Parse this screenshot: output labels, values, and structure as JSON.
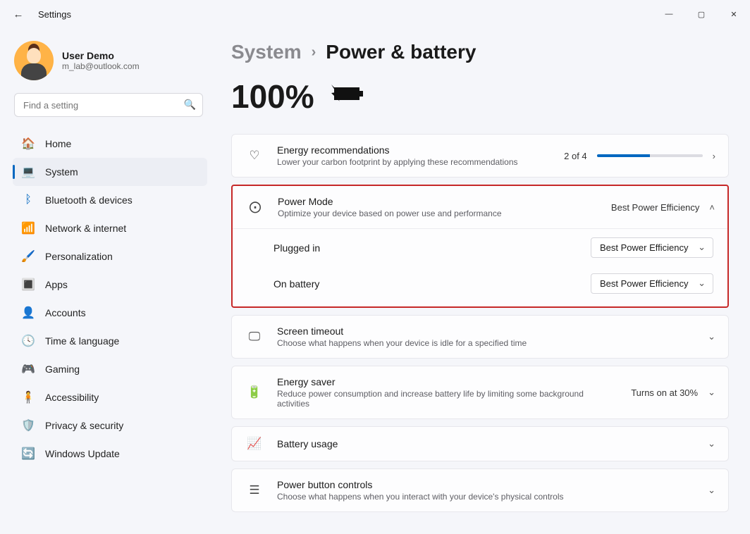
{
  "window": {
    "title": "Settings"
  },
  "user": {
    "name": "User Demo",
    "email": "m_lab@outlook.com"
  },
  "search": {
    "placeholder": "Find a setting"
  },
  "nav": {
    "items": [
      {
        "label": "Home"
      },
      {
        "label": "System"
      },
      {
        "label": "Bluetooth & devices"
      },
      {
        "label": "Network & internet"
      },
      {
        "label": "Personalization"
      },
      {
        "label": "Apps"
      },
      {
        "label": "Accounts"
      },
      {
        "label": "Time & language"
      },
      {
        "label": "Gaming"
      },
      {
        "label": "Accessibility"
      },
      {
        "label": "Privacy & security"
      },
      {
        "label": "Windows Update"
      }
    ]
  },
  "breadcrumb": {
    "parent": "System",
    "current": "Power & battery"
  },
  "battery": {
    "percent": "100%"
  },
  "energy_rec": {
    "title": "Energy recommendations",
    "sub": "Lower your carbon footprint by applying these recommendations",
    "count_text": "2 of 4",
    "progress_pct": 50
  },
  "power_mode": {
    "title": "Power Mode",
    "sub": "Optimize your device based on power use and performance",
    "summary": "Best Power Efficiency",
    "plugged_label": "Plugged in",
    "plugged_value": "Best Power Efficiency",
    "battery_label": "On battery",
    "battery_value": "Best Power Efficiency"
  },
  "screen_timeout": {
    "title": "Screen timeout",
    "sub": "Choose what happens when your device is idle for a specified time"
  },
  "energy_saver": {
    "title": "Energy saver",
    "sub": "Reduce power consumption and increase battery life by limiting some background activities",
    "value": "Turns on at 30%"
  },
  "battery_usage": {
    "title": "Battery usage"
  },
  "power_button": {
    "title": "Power button controls",
    "sub": "Choose what happens when you interact with your device's physical controls"
  }
}
